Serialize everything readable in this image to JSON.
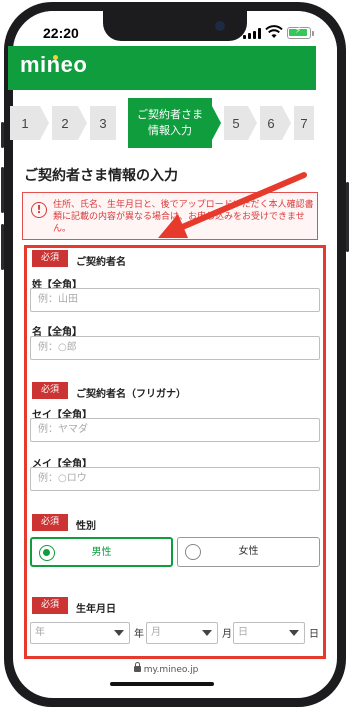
{
  "status_bar": {
    "time": "22:20"
  },
  "header": {
    "logo": "mineo"
  },
  "stepper": {
    "steps": [
      "1",
      "2",
      "3",
      "ご契約者さま",
      "情報入力",
      "5",
      "6",
      "7"
    ]
  },
  "page": {
    "title": "ご契約者さま情報の入力",
    "alert_icon": "!",
    "alert_text": "住所、氏名、生年月日と、後でアップロードいただく本人確認書類に記載の内容が異なる場合は、お申し込みをお受けできません。"
  },
  "form": {
    "required_badge": "必須",
    "name_section": "ご契約者名",
    "last_name_label": "姓【全角】",
    "last_name_placeholder": "例：山田",
    "first_name_label": "名【全角】",
    "first_name_placeholder": "例：○郎",
    "kana_section": "ご契約者名（フリガナ）",
    "last_kana_label": "セイ【全角】",
    "last_kana_placeholder": "例：ヤマダ",
    "first_kana_label": "メイ【全角】",
    "first_kana_placeholder": "例：○ロウ",
    "gender_section": "性別",
    "gender_male": "男性",
    "gender_female": "女性",
    "birth_section": "生年月日",
    "year_placeholder": "年",
    "year_unit": "年",
    "month_placeholder": "月",
    "month_unit": "月",
    "day_placeholder": "日",
    "day_unit": "日"
  },
  "browser": {
    "url": "my.mineo.jp"
  },
  "colors": {
    "brand": "#0f9d3e",
    "highlight": "#e53a2c",
    "required": "#cc3333"
  }
}
